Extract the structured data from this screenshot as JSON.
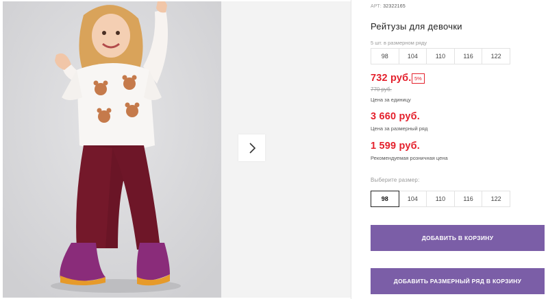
{
  "gallery": {
    "photo_alt": "",
    "next_icon": "chevron-right-icon"
  },
  "product": {
    "article_label": "АРТ:",
    "article_value": "32322165",
    "title": "Рейтузы для девочки",
    "size_row_label": "5 шт. в размерном ряду",
    "size_row": [
      "98",
      "104",
      "110",
      "116",
      "122"
    ],
    "unit_price": "732 руб.",
    "discount": "5%",
    "old_price": "770 руб.",
    "unit_price_note": "Цена за единицу",
    "row_price": "3 660 руб.",
    "row_price_note": "Цена за размерный ряд",
    "retail_price": "1 599 руб.",
    "retail_price_note": "Рекомендуемая розничная цена",
    "choose_size_label": "Выберите размер:",
    "sizes": [
      "98",
      "104",
      "110",
      "116",
      "122"
    ],
    "selected_size": "98",
    "add_to_cart": "ДОБАВИТЬ В КОРЗИНУ",
    "add_row_to_cart": "ДОБАВИТЬ РАЗМЕРНЫЙ РЯД В КОРЗИНУ"
  },
  "colors": {
    "price_red": "#e4202c",
    "button_purple": "#7b5ea7"
  }
}
